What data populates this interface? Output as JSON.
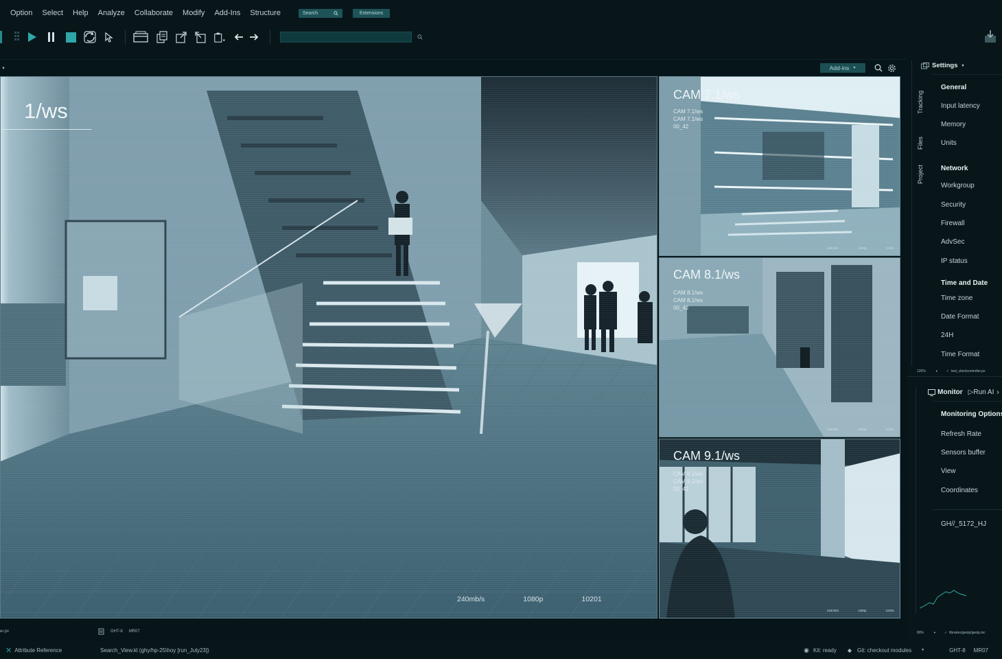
{
  "menu": {
    "items": [
      "Option",
      "Select",
      "Help",
      "Analyze",
      "Collaborate",
      "Modify",
      "Add-Ins",
      "Structure"
    ],
    "search_label": "Search",
    "extensions_label": "Extensions"
  },
  "viewport": {
    "addins_label": "Add-ins"
  },
  "main_cam": {
    "title": "1/ws",
    "stats": [
      "240mb/s",
      "1080p",
      "10201"
    ]
  },
  "tiles": [
    {
      "title": "CAM 7.1/ws",
      "sub": [
        "CAM 7.1/ws",
        "CAM 7.1/ws",
        "00_42"
      ],
      "stats": [
        "240mb/s",
        "1080p",
        "10201"
      ]
    },
    {
      "title": "CAM 8.1/ws",
      "sub": [
        "CAM 8.1/ws",
        "CAM 8.1/ws",
        "00_42"
      ],
      "stats": [
        "240mb/s",
        "1080p",
        "10201"
      ]
    },
    {
      "title": "CAM 9.1/ws",
      "sub": [
        "CAM 9.1/ws",
        "CAM 9.1/ws",
        "00_42"
      ],
      "stats": [
        "240mb/s",
        "1080p",
        "10201"
      ]
    }
  ],
  "right_panel": {
    "settings_label": "Settings",
    "tabs": [
      "Tracking",
      "Files",
      "Project"
    ],
    "settings_items": [
      {
        "label": "General",
        "header": true
      },
      {
        "label": "Input latency",
        "header": false
      },
      {
        "label": "Memory",
        "header": false
      },
      {
        "label": "Units",
        "header": false
      },
      {
        "label": "Network",
        "header": true
      },
      {
        "label": "Workgroup",
        "header": false
      },
      {
        "label": "Security",
        "header": false
      },
      {
        "label": "Firewall",
        "header": false
      },
      {
        "label": "AdvSec",
        "header": false
      },
      {
        "label": "IP status",
        "header": false
      },
      {
        "label": "Time and Date",
        "header": true
      },
      {
        "label": "Time zone",
        "header": false
      },
      {
        "label": "Date Format",
        "header": false
      },
      {
        "label": "24H",
        "header": false
      },
      {
        "label": "Time Format",
        "header": false
      }
    ],
    "status_zoom": "120%",
    "status_file": "test_clientcontroller.px",
    "monitor_label": "Monitor",
    "run_ai_label": "Run AI",
    "monitor_items": [
      {
        "label": "Monitoring Options",
        "header": true
      },
      {
        "label": "Refresh Rate",
        "header": false
      },
      {
        "label": "Sensors buffer",
        "header": false
      },
      {
        "label": "View",
        "header": false
      },
      {
        "label": "Coordinates",
        "header": false
      }
    ],
    "monitor_id": "GH//_5172_HJ",
    "status2_zoom": "80%",
    "status2_file": "libraries/geoip/geoip.inc"
  },
  "statusbar1": {
    "left": "er.px",
    "code1": "GHT-8",
    "code2": "MR07"
  },
  "statusbar2": {
    "attr_ref": "Attribute Reference",
    "search_view": "Search_View.kl (ghy/hp-25\\hoy [run_July23])",
    "kit_ready": "Kit: ready",
    "git": "Git: checkout modules",
    "code1": "GHT-8",
    "code2": "MR07"
  }
}
